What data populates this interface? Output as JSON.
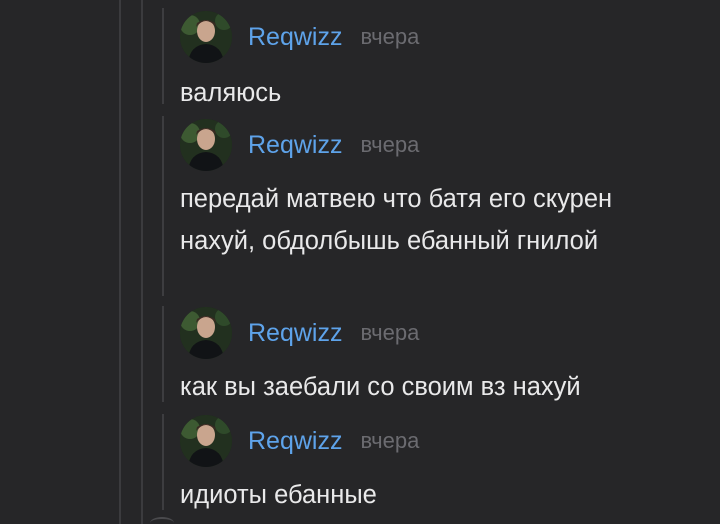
{
  "comments": [
    {
      "author": "Reqwizz",
      "time": "вчера",
      "text": "валяюсь",
      "avatar_icon": "user-photo-avatar"
    },
    {
      "author": "Reqwizz",
      "time": "вчера",
      "text": "передай матвею что батя его скурен нахуй, обдолбышь ебанный гнилой",
      "avatar_icon": "user-photo-avatar"
    },
    {
      "author": "Reqwizz",
      "time": "вчера",
      "text": "как вы заебали со своим вз нахуй",
      "avatar_icon": "user-photo-avatar"
    },
    {
      "author": "Reqwizz",
      "time": "вчера",
      "text": "идиоты ебанные",
      "avatar_icon": "user-photo-avatar"
    }
  ],
  "colors": {
    "background": "#262628",
    "author": "#5ea3ea",
    "text": "#e9e9ea",
    "timestamp": "#6b6b70",
    "thread_line": "#3b3b3e"
  }
}
